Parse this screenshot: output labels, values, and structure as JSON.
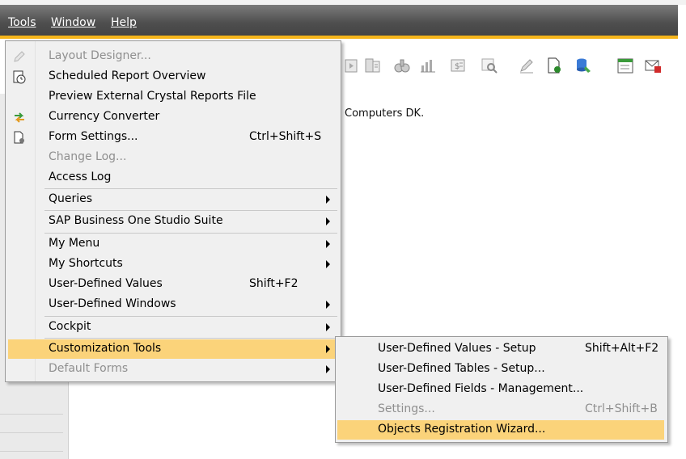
{
  "menubar": {
    "items": [
      {
        "label": "Tools"
      },
      {
        "label": "Window"
      },
      {
        "label": "Help"
      }
    ]
  },
  "workspace": {
    "company_text": "Computers DK."
  },
  "tools_menu": {
    "items": [
      {
        "label": "Layout Designer...",
        "shortcut": "",
        "disabled": true,
        "submenu": false,
        "icon": "pencil-icon"
      },
      {
        "label": "Scheduled Report Overview",
        "shortcut": "",
        "disabled": false,
        "submenu": false,
        "icon": "clock-report-icon"
      },
      {
        "label": "Preview External Crystal Reports File",
        "shortcut": "",
        "disabled": false,
        "submenu": false,
        "icon": ""
      },
      {
        "label": "Currency Converter",
        "shortcut": "",
        "disabled": false,
        "submenu": false,
        "icon": "currency-arrows-icon"
      },
      {
        "label": "Form Settings...",
        "shortcut": "Ctrl+Shift+S",
        "disabled": false,
        "submenu": false,
        "icon": "form-settings-icon"
      },
      {
        "label": "Change Log...",
        "shortcut": "",
        "disabled": true,
        "submenu": false,
        "icon": ""
      },
      {
        "label": "Access Log",
        "shortcut": "",
        "disabled": false,
        "submenu": false,
        "icon": ""
      },
      {
        "label": "Queries",
        "shortcut": "",
        "disabled": false,
        "submenu": true,
        "icon": ""
      },
      {
        "label": "SAP Business One Studio Suite",
        "shortcut": "",
        "disabled": false,
        "submenu": true,
        "icon": ""
      },
      {
        "label": "My Menu",
        "shortcut": "",
        "disabled": false,
        "submenu": true,
        "icon": ""
      },
      {
        "label": "My Shortcuts",
        "shortcut": "",
        "disabled": false,
        "submenu": true,
        "icon": ""
      },
      {
        "label": "User-Defined Values",
        "shortcut": "Shift+F2",
        "disabled": false,
        "submenu": false,
        "icon": ""
      },
      {
        "label": "User-Defined Windows",
        "shortcut": "",
        "disabled": false,
        "submenu": true,
        "icon": ""
      },
      {
        "label": "Cockpit",
        "shortcut": "",
        "disabled": false,
        "submenu": true,
        "icon": ""
      },
      {
        "label": "Customization Tools",
        "shortcut": "",
        "disabled": false,
        "submenu": true,
        "highlight": true,
        "icon": ""
      },
      {
        "label": "Default Forms",
        "shortcut": "",
        "disabled": true,
        "submenu": true,
        "icon": ""
      }
    ]
  },
  "customization_submenu": {
    "items": [
      {
        "label": "User-Defined Values - Setup",
        "shortcut": "Shift+Alt+F2",
        "disabled": false
      },
      {
        "label": "User-Defined Tables - Setup...",
        "shortcut": "",
        "disabled": false
      },
      {
        "label": "User-Defined Fields - Management...",
        "shortcut": "",
        "disabled": false
      },
      {
        "label": "Settings...",
        "shortcut": "Ctrl+Shift+B",
        "disabled": true
      },
      {
        "label": "Objects Registration Wizard...",
        "shortcut": "",
        "disabled": false,
        "highlight": true
      }
    ]
  },
  "colors": {
    "highlight": "#fbd37a",
    "menubar_accent": "#f5b51b",
    "disabled_text": "#8f8f8f"
  }
}
